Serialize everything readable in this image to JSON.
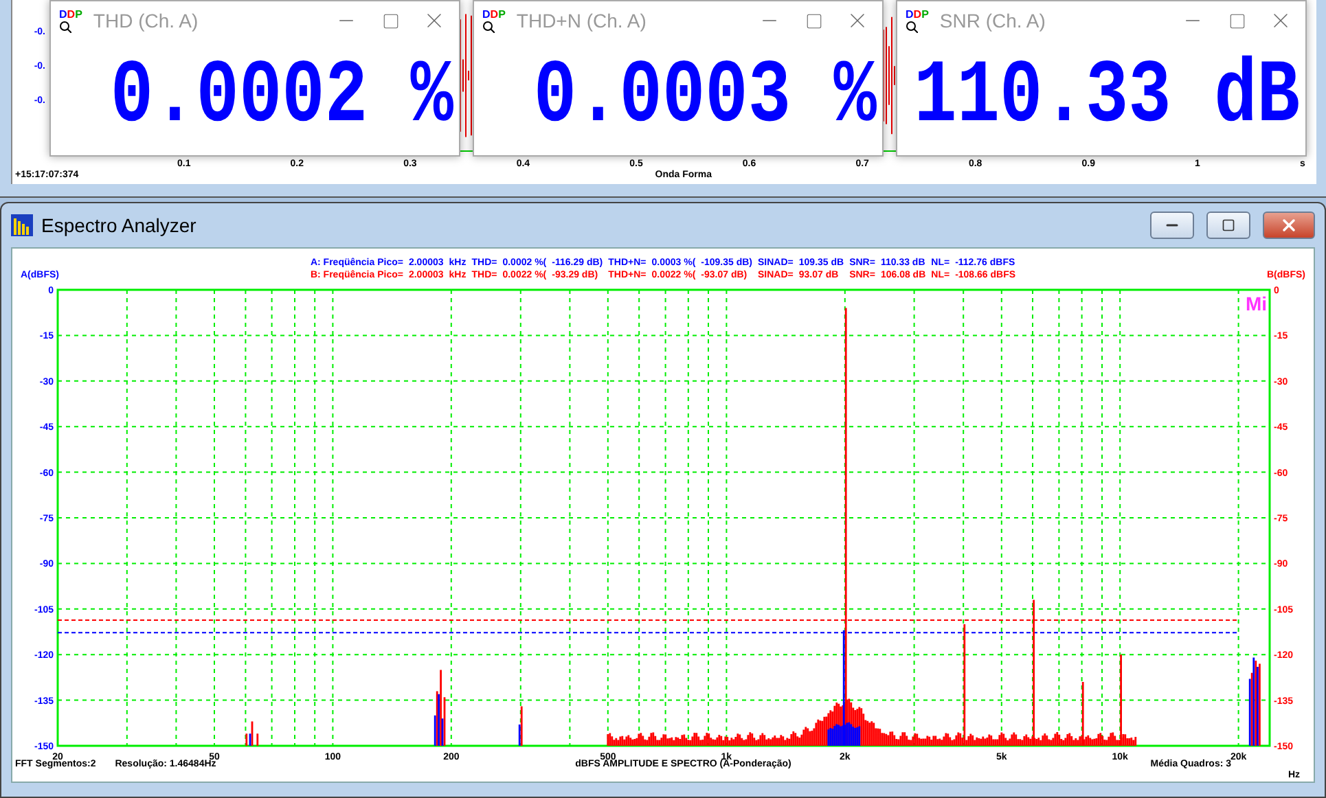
{
  "waveform_window": {
    "y_labels": [
      "-0.",
      "-0.",
      "-0."
    ],
    "x_ticks": [
      "0.1",
      "0.2",
      "0.3",
      "0.4",
      "0.5",
      "0.6",
      "0.7",
      "0.8",
      "0.9",
      "1"
    ],
    "x_unit": "s",
    "timestamp": "+15:17:07:374",
    "title": "Onda Forma"
  },
  "meter_windows": [
    {
      "logo": "DDP",
      "title": "THD (Ch. A)",
      "value": "0.0002 %"
    },
    {
      "logo": "DDP",
      "title": "THD+N (Ch. A)",
      "value": "0.0003 %"
    },
    {
      "logo": "DDP",
      "title": "SNR (Ch. A)",
      "value": "110.33 dB"
    }
  ],
  "spectrum_window": {
    "title": "Espectro Analyzer",
    "left_axis_label": "A(dBFS)",
    "right_axis_label": "B(dBFS)",
    "info_rows": [
      {
        "color": "#0000ff",
        "cells": [
          "A: Freqüência Pico=",
          "2.00003",
          "kHz",
          "THD=",
          "0.0002 %(",
          "-116.29 dB)",
          "THD+N=",
          "0.0003 %(",
          "-109.35 dB)",
          "SINAD=",
          "109.35 dB",
          "SNR=",
          "110.33 dB",
          "NL=",
          "-112.76 dBFS"
        ]
      },
      {
        "color": "#ff0000",
        "cells": [
          "B: Freqüência Pico=",
          "2.00003",
          "kHz",
          "THD=",
          "0.0022 %(",
          "-93.29 dB)",
          "THD+N=",
          "0.0022 %(",
          "-93.07 dB)",
          "SINAD=",
          "93.07 dB",
          "SNR=",
          "106.08 dB",
          "NL=",
          "-108.66 dBFS"
        ]
      }
    ],
    "logo": "Mi",
    "left_axis_ticks": [
      "0",
      "-15",
      "-30",
      "-45",
      "-60",
      "-75",
      "-90",
      "-105",
      "-120",
      "-135",
      "-150"
    ],
    "right_axis_ticks": [
      "0",
      "-15",
      "-30",
      "-45",
      "-60",
      "-75",
      "-90",
      "-105",
      "-120",
      "-135",
      "-150"
    ],
    "x_axis_ticks": [
      "20",
      "50",
      "100",
      "200",
      "500",
      "1k",
      "2k",
      "5k",
      "10k",
      "20k"
    ],
    "footer": {
      "segments": "FFT  Segmentos:2",
      "resolution": "Resolução: 1.46484Hz",
      "caption": "dBFS AMPLITUDE E SPECTRO (A-Ponderação)",
      "averaging": "Média Quadros: 3",
      "unit": "Hz"
    }
  }
}
